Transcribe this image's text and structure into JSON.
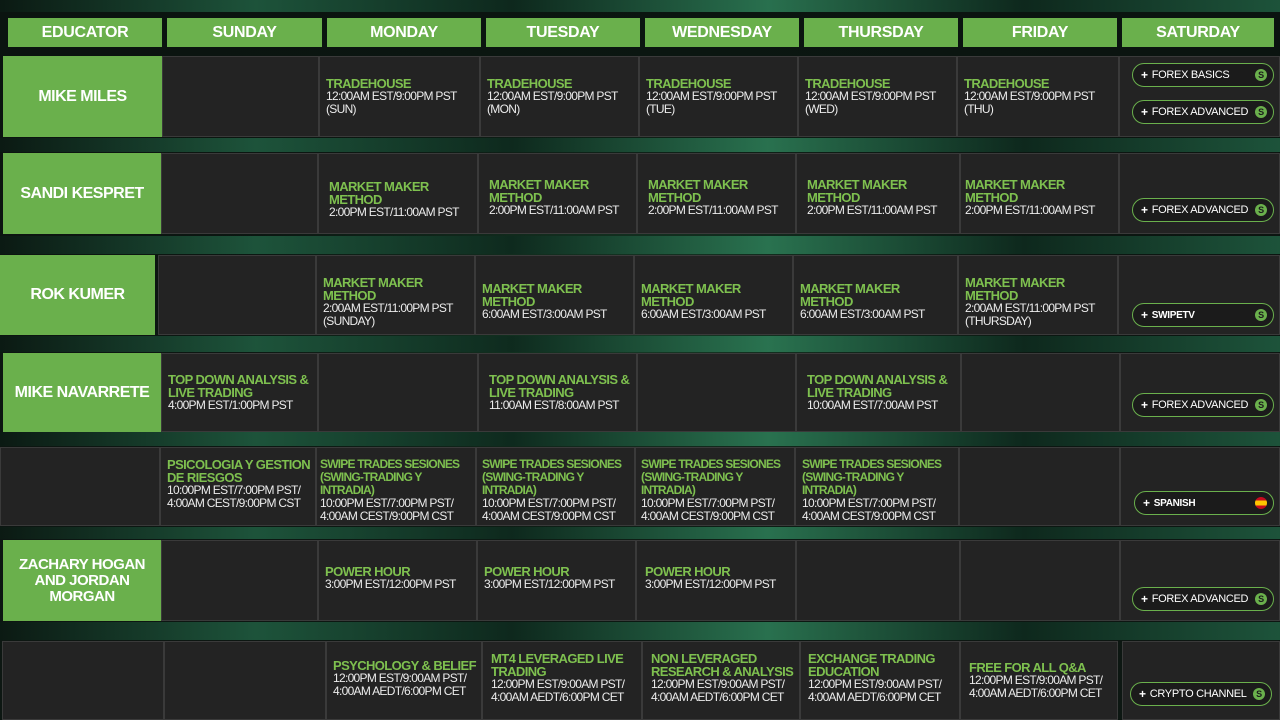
{
  "headers": {
    "educator": "EDUCATOR",
    "sunday": "SUNDAY",
    "monday": "MONDAY",
    "tuesday": "TUESDAY",
    "wednesday": "WEDNESDAY",
    "thursday": "THURSDAY",
    "friday": "FRIDAY",
    "saturday": "SATURDAY"
  },
  "rows": {
    "r1": {
      "educator": "MIKE MILES",
      "mon": {
        "title": "TRADEHOUSE",
        "time": "12:00AM EST/9:00PM PST (SUN)"
      },
      "tue": {
        "title": "TRADEHOUSE",
        "time": "12:00AM EST/9:00PM PST (MON)"
      },
      "wed": {
        "title": "TRADEHOUSE",
        "time": "12:00AM EST/9:00PM PST (TUE)"
      },
      "thu": {
        "title": "TRADEHOUSE",
        "time": "12:00AM EST/9:00PM PST (WED)"
      },
      "fri": {
        "title": "TRADEHOUSE",
        "time": "12:00AM EST/9:00PM PST (THU)"
      },
      "pill1": "FOREX BASICS",
      "pill2": "FOREX ADVANCED"
    },
    "r2": {
      "educator": "SANDI KESPRET",
      "mon": {
        "title": "MARKET MAKER METHOD",
        "time": "2:00PM EST/11:00AM PST"
      },
      "tue": {
        "title": "MARKET MAKER METHOD",
        "time": "2:00PM EST/11:00AM PST"
      },
      "wed": {
        "title": "MARKET MAKER METHOD",
        "time": "2:00PM EST/11:00AM PST"
      },
      "thu": {
        "title": "MARKET MAKER METHOD",
        "time": "2:00PM EST/11:00AM PST"
      },
      "fri": {
        "title": "MARKET MAKER METHOD",
        "time": "2:00PM EST/11:00AM PST"
      },
      "pill": "FOREX ADVANCED"
    },
    "r3": {
      "educator": "ROK KUMER",
      "mon": {
        "title": "MARKET MAKER METHOD",
        "time": "2:00AM EST/11:00PM PST (SUNDAY)"
      },
      "tue": {
        "title": "MARKET MAKER METHOD",
        "time": "6:00AM EST/3:00AM PST"
      },
      "wed": {
        "title": "MARKET MAKER METHOD",
        "time": "6:00AM EST/3:00AM PST"
      },
      "thu": {
        "title": "MARKET MAKER METHOD",
        "time": "6:00AM EST/3:00AM PST"
      },
      "fri": {
        "title": "MARKET MAKER METHOD",
        "time": "2:00AM EST/11:00PM PST (THURSDAY)"
      },
      "pill": "SWIPETV"
    },
    "r4": {
      "educator": "MIKE NAVARRETE",
      "sun": {
        "title": "TOP DOWN ANALYSIS & LIVE TRADING",
        "time": "4:00PM EST/1:00PM PST"
      },
      "tue": {
        "title": "TOP DOWN ANALYSIS & LIVE TRADING",
        "time": "11:00AM EST/8:00AM PST"
      },
      "thu": {
        "title": "TOP DOWN ANALYSIS & LIVE TRADING",
        "time": "10:00AM EST/7:00AM PST"
      },
      "pill": "FOREX ADVANCED"
    },
    "r5": {
      "sun": {
        "title": "PSICOLOGIA Y GESTION DE RIESGOS",
        "time": "10:00PM EST/7:00PM PST/ 4:00AM CEST/9:00PM CST"
      },
      "mon": {
        "title": "SWIPE TRADES SESIONES (SWING-TRADING Y INTRADIA)",
        "time": "10:00PM EST/7:00PM PST/ 4:00AM CEST/9:00PM CST"
      },
      "tue": {
        "title": "SWIPE TRADES SESIONES (SWING-TRADING Y INTRADIA)",
        "time": "10:00PM EST/7:00PM PST/ 4:00AM CEST/9:00PM CST"
      },
      "wed": {
        "title": "SWIPE TRADES SESIONES (SWING-TRADING Y INTRADIA)",
        "time": "10:00PM EST/7:00PM PST/ 4:00AM CEST/9:00PM CST"
      },
      "thu": {
        "title": "SWIPE TRADES SESIONES (SWING-TRADING Y INTRADIA)",
        "time": "10:00PM EST/7:00PM PST/ 4:00AM CEST/9:00PM CST"
      },
      "pill": "SPANISH"
    },
    "r6": {
      "educator": "ZACHARY HOGAN AND JORDAN MORGAN",
      "mon": {
        "title": "POWER HOUR",
        "time": "3:00PM EST/12:00PM PST"
      },
      "tue": {
        "title": "POWER HOUR",
        "time": "3:00PM EST/12:00PM PST"
      },
      "wed": {
        "title": "POWER HOUR",
        "time": "3:00PM EST/12:00PM PST"
      },
      "pill": "FOREX ADVANCED"
    },
    "r7": {
      "mon": {
        "title": "PSYCHOLOGY & BELIEF",
        "time": "12:00PM EST/9:00AM PST/ 4:00AM AEDT/6:00PM CET"
      },
      "tue": {
        "title": "MT4 LEVERAGED LIVE TRADING",
        "time": "12:00PM EST/9:00AM PST/ 4:00AM AEDT/6:00PM CET"
      },
      "wed": {
        "title": "NON LEVERAGED RESEARCH & ANALYSIS",
        "time": "12:00PM EST/9:00AM PST/ 4:00AM AEDT/6:00PM CET"
      },
      "thu": {
        "title": "EXCHANGE TRADING EDUCATION",
        "time": "12:00PM EST/9:00AM PST/ 4:00AM AEDT/6:00PM CET"
      },
      "fri": {
        "title": "FREE FOR ALL Q&A",
        "time": "12:00PM EST/9:00AM PST/ 4:00AM AEDT/6:00PM CET"
      },
      "pill": "CRYPTO CHANNEL"
    }
  },
  "pill_icon": "swipe-logo-icon",
  "flag_icon": "spain-flag-icon"
}
